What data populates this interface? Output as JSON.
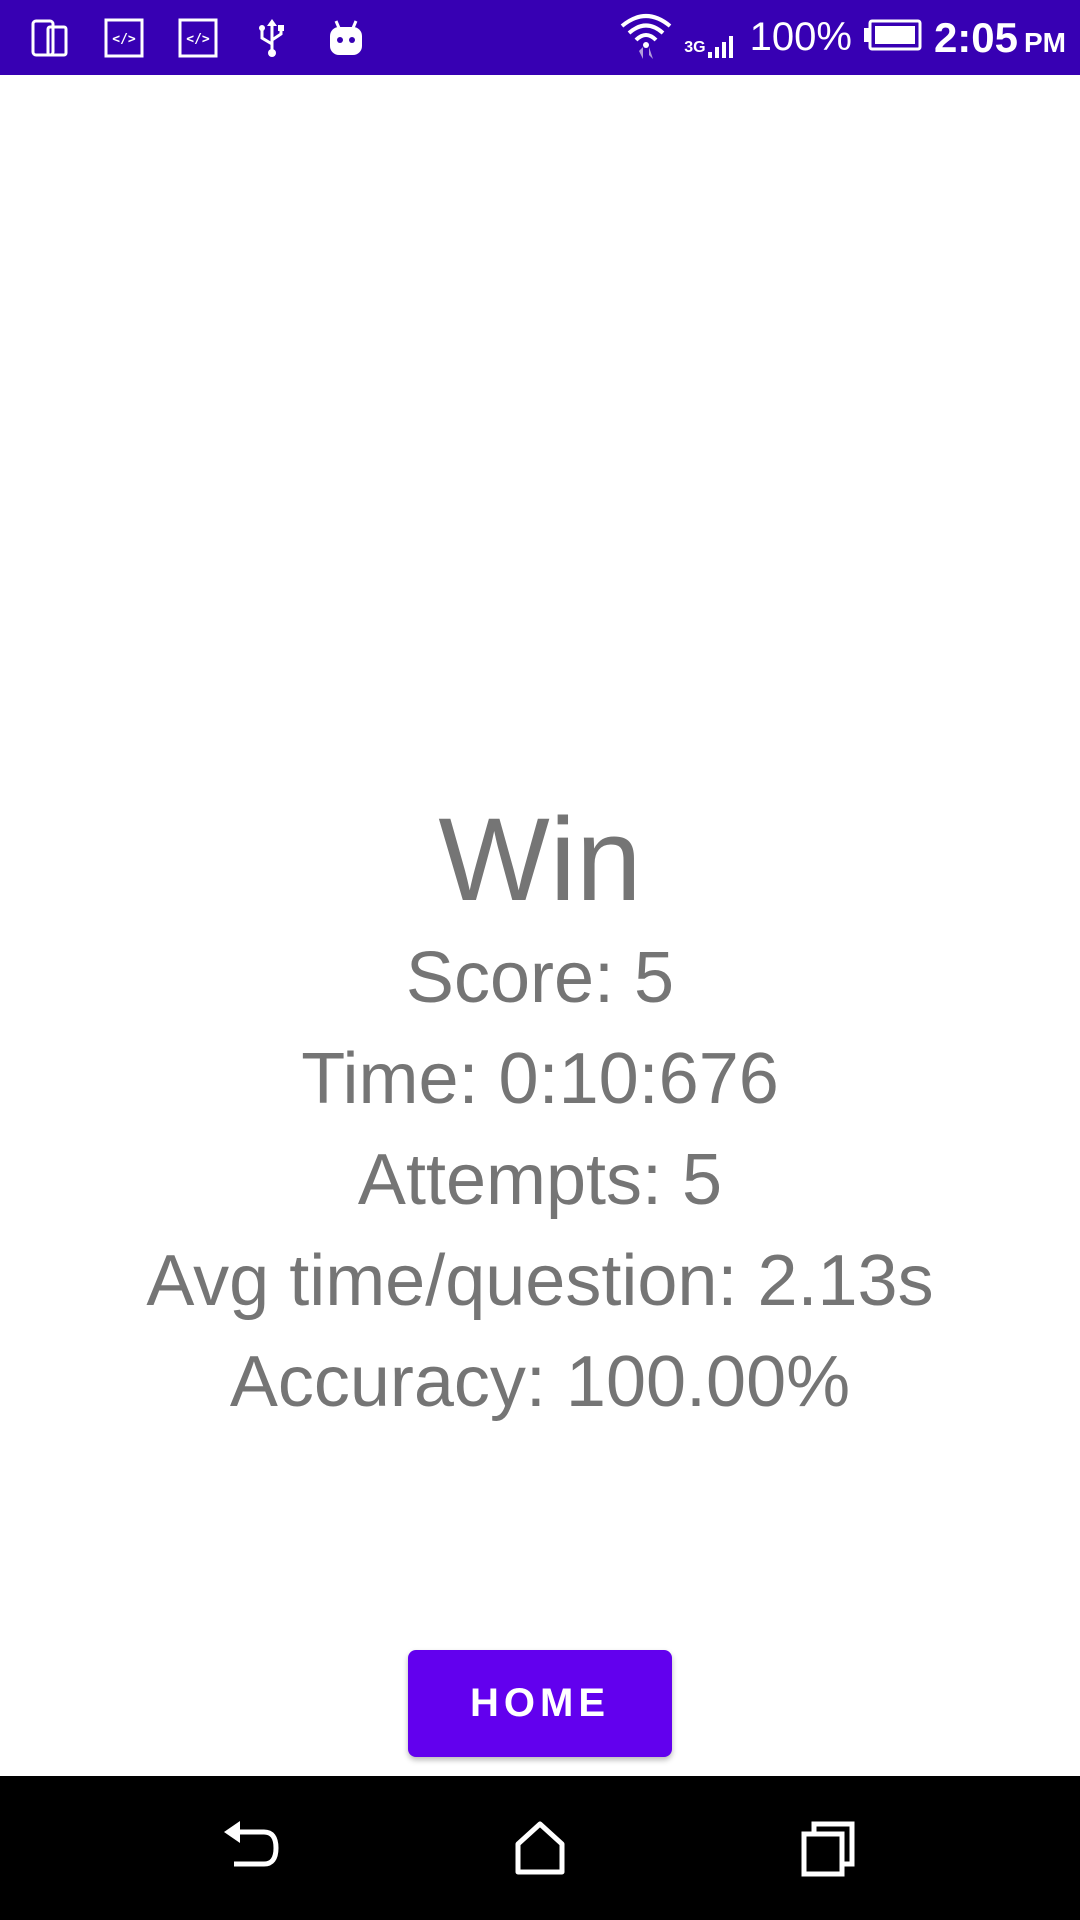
{
  "status_bar": {
    "battery_percent": "100%",
    "network": "3G",
    "time": "2:05",
    "ampm": "PM",
    "background_color": "#3700b3",
    "icons_left": [
      "phone-mirror-icon",
      "code-icon",
      "code-icon",
      "usb-icon",
      "android-icon"
    ],
    "icons_right": [
      "wifi-icon",
      "signal-icon",
      "battery-icon"
    ]
  },
  "results": {
    "title": "Win",
    "score": "Score: 5",
    "time": "Time: 0:10:676",
    "attempts": "Attempts: 5",
    "avg_time": "Avg time/question: 2.13s",
    "accuracy": "Accuracy: 100.00%",
    "text_color": "#757575"
  },
  "home_button": {
    "label": "HOME",
    "color": "#6200ee"
  },
  "nav_bar": {
    "icons": [
      "back-icon",
      "home-icon",
      "recents-icon"
    ]
  }
}
